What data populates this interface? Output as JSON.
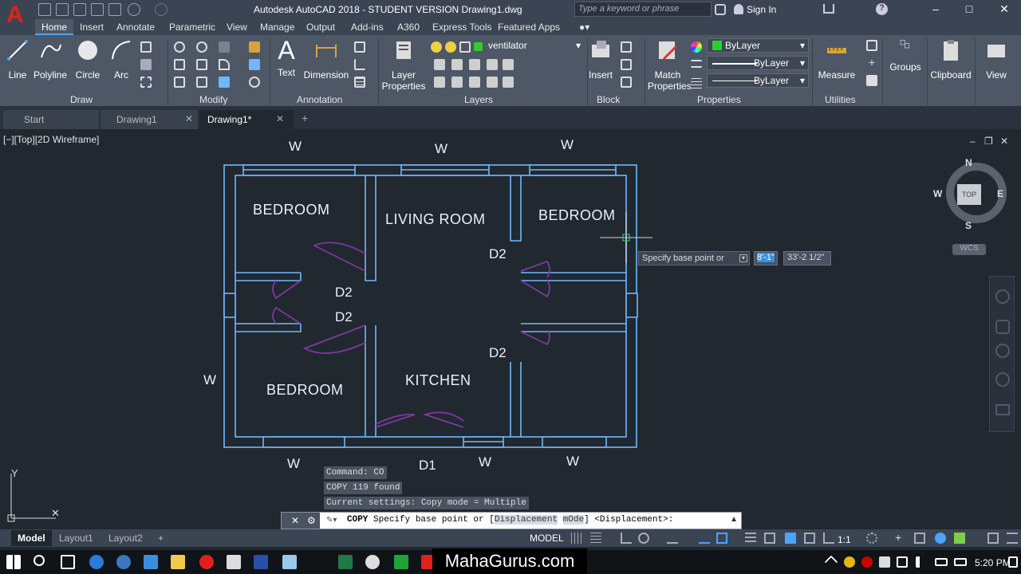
{
  "title": "Autodesk AutoCAD 2018 - STUDENT VERSION    Drawing1.dwg",
  "search_placeholder": "Type a keyword or phrase",
  "sign_in": "Sign In",
  "ribbon_tabs": [
    "Home",
    "Insert",
    "Annotate",
    "Parametric",
    "View",
    "Manage",
    "Output",
    "Add-ins",
    "A360",
    "Express Tools",
    "Featured Apps"
  ],
  "draw": {
    "line": "Line",
    "polyline": "Polyline",
    "circle": "Circle",
    "arc": "Arc",
    "label": "Draw"
  },
  "modify_label": "Modify",
  "annotation": {
    "text": "Text",
    "dimension": "Dimension",
    "label": "Annotation"
  },
  "layers": {
    "layer_props_1": "Layer",
    "layer_props_2": "Properties",
    "current_layer": "ventilator",
    "label": "Layers"
  },
  "block": {
    "insert": "Insert",
    "label": "Block"
  },
  "properties": {
    "match_1": "Match",
    "match_2": "Properties",
    "color": "ByLayer",
    "linetype": "ByLayer",
    "lineweight": "ByLayer",
    "label": "Properties"
  },
  "utilities": {
    "measure": "Measure",
    "label": "Utilities"
  },
  "groups": "Groups",
  "clipboard": "Clipboard",
  "view": "View",
  "file_tabs": {
    "start": "Start",
    "tab1": "Drawing1",
    "tab2": "Drawing1*",
    "add": "+"
  },
  "viewport_label": "[−][Top][2D Wireframe]",
  "rooms": {
    "bedroom_tl": "BEDROOM",
    "living": "LIVING ROOM",
    "bedroom_tr": "BEDROOM",
    "bedroom_bl": "BEDROOM",
    "kitchen": "KITCHEN"
  },
  "marks": {
    "w_top_1": "W",
    "w_top_2": "W",
    "w_top_3": "W",
    "w_left": "W",
    "w_bottom_1": "W",
    "w_bottom_2": "W",
    "w_bottom_3": "W",
    "d2_1": "D2",
    "d2_2": "D2",
    "d2_3": "D2",
    "d2_4": "D2",
    "d1": "D1"
  },
  "tooltip": {
    "prompt": "Specify base point or",
    "value1": "8'-1\"",
    "value2": "33'-2 1/2\""
  },
  "viewcube": {
    "n": "N",
    "s": "S",
    "e": "E",
    "w": "W",
    "top": "TOP",
    "wcs": "WCS"
  },
  "command_history": [
    "Command: CO",
    "COPY 119 found",
    "Current settings:  Copy mode = Multiple"
  ],
  "command_line": {
    "prefix": "COPY",
    "prompt": "Specify base point or [",
    "opt1": "Displacement",
    "opt2": "mOde",
    "suffix": "] <Displacement>:"
  },
  "layout_tabs": {
    "model": "Model",
    "layout1": "Layout1",
    "layout2": "Layout2",
    "add": "+"
  },
  "status": {
    "model": "MODEL",
    "scale": "1:1"
  },
  "watermark": "MahaGurus.com",
  "clock": "5:20 PM",
  "colors": {
    "accent": "#4da3ff",
    "wall": "#6fb8ff",
    "door": "#7a3aa0",
    "logo": "#e0201c",
    "bylayer_swatch": "#2bd02b"
  }
}
